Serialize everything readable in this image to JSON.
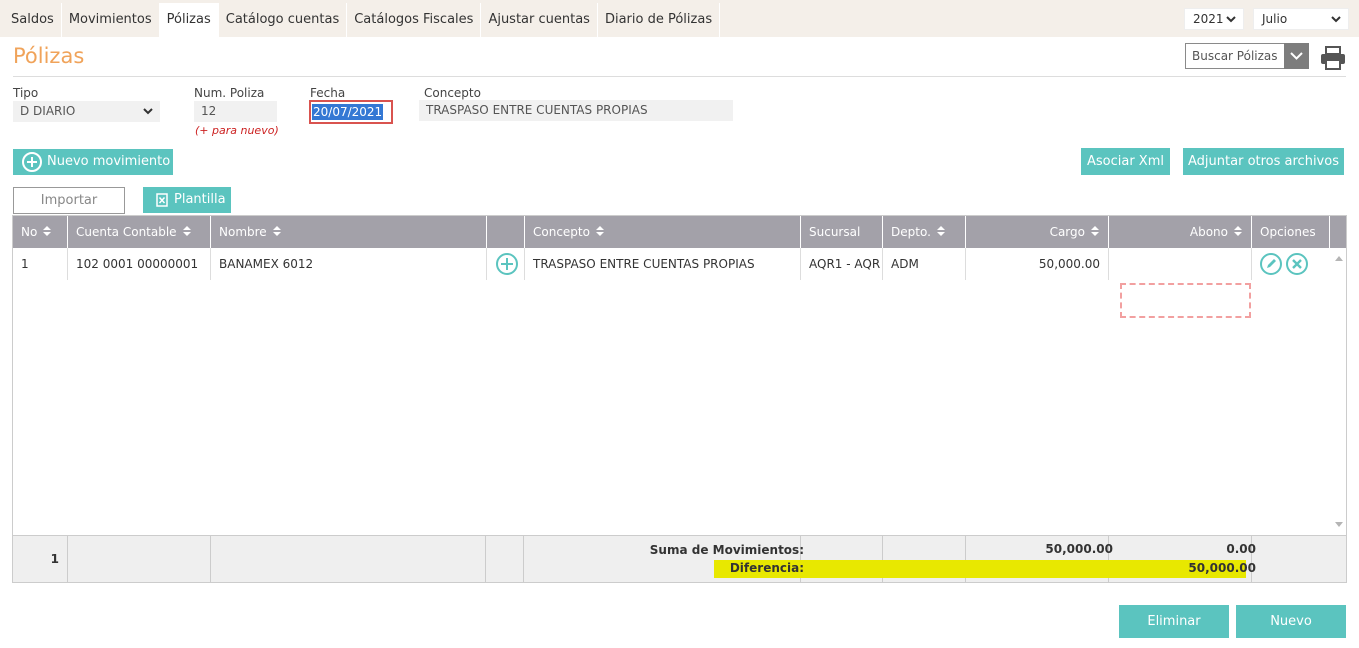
{
  "nav": {
    "tabs": [
      "Saldos",
      "Movimientos",
      "Pólizas",
      "Catálogo cuentas",
      "Catálogos Fiscales",
      "Ajustar cuentas",
      "Diario de Pólizas"
    ],
    "active_tab": "Pólizas",
    "year": "2021",
    "month": "Julio"
  },
  "header": {
    "title": "Pólizas",
    "search_placeholder": "Buscar Pólizas"
  },
  "form": {
    "tipo_label": "Tipo",
    "tipo_value": "D DIARIO",
    "num_label": "Num. Poliza",
    "num_value": "12",
    "num_hint": "(+ para nuevo)",
    "fecha_label": "Fecha",
    "fecha_value": "20/07/2021",
    "concepto_label": "Concepto",
    "concepto_value": "TRASPASO ENTRE CUENTAS PROPIAS"
  },
  "buttons": {
    "nuevo_movimiento": "Nuevo movimiento",
    "asociar_xml": "Asociar Xml",
    "adjuntar": "Adjuntar otros archivos",
    "importar": "Importar",
    "plantilla": "Plantilla",
    "eliminar": "Eliminar",
    "nuevo": "Nuevo"
  },
  "table": {
    "columns": [
      "No",
      "Cuenta Contable",
      "Nombre",
      "",
      "Concepto",
      "Sucursal",
      "Depto.",
      "Cargo",
      "Abono",
      "Opciones"
    ],
    "rows": [
      {
        "no": "1",
        "cuenta": "102 0001 00000001",
        "nombre": "BANAMEX 6012",
        "concepto": "TRASPASO ENTRE CUENTAS PROPIAS",
        "sucursal": "AQR1 - AQR",
        "depto": "ADM",
        "cargo": "50,000.00",
        "abono": ""
      }
    ],
    "footer": {
      "count": "1",
      "suma_label": "Suma de Movimientos:",
      "suma_cargo": "50,000.00",
      "suma_abono": "0.00",
      "diferencia_label": "Diferencia:",
      "diferencia_abono": "50,000.00"
    }
  },
  "colors": {
    "accent": "#5bc4bf",
    "title": "#f0a35a",
    "header_bg": "#a3a1a9",
    "highlight": "#e8e800"
  }
}
